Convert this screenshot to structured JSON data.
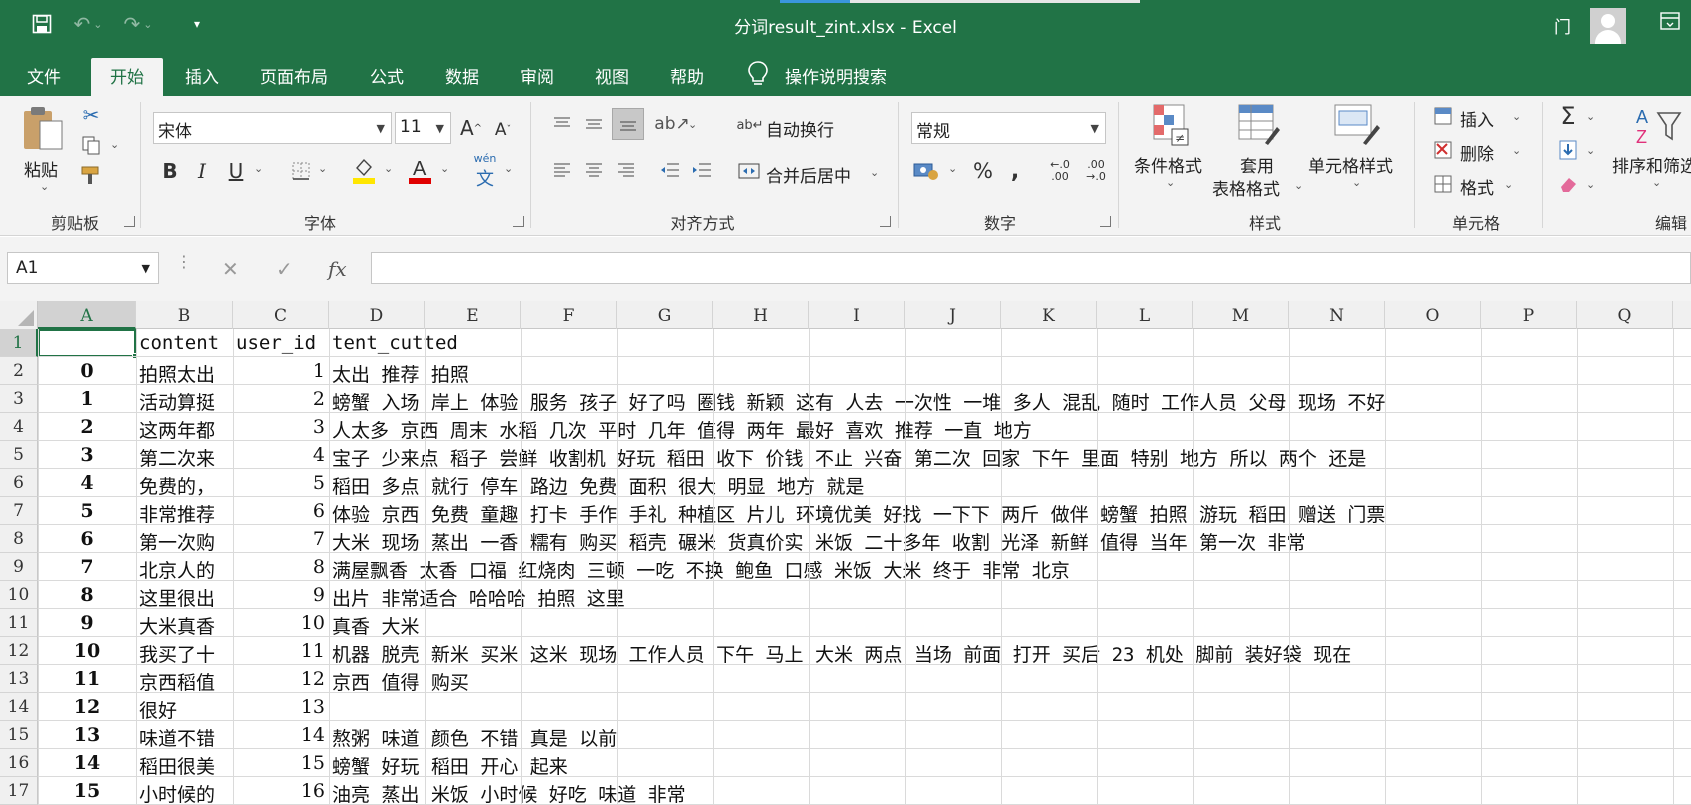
{
  "app": {
    "title": "分词result_zint.xlsx  -  Excel",
    "account_name": "门"
  },
  "tabs": [
    "文件",
    "开始",
    "插入",
    "页面布局",
    "公式",
    "数据",
    "审阅",
    "视图",
    "帮助"
  ],
  "tell_me": "操作说明搜索",
  "ribbon": {
    "clipboard": {
      "paste": "粘贴",
      "label": "剪贴板"
    },
    "font": {
      "name": "宋体",
      "size": "11",
      "label": "字体",
      "phonetic": "wén"
    },
    "alignment": {
      "wrap": "自动换行",
      "merge": "合并后居中",
      "label": "对齐方式"
    },
    "number": {
      "format": "常规",
      "label": "数字"
    },
    "styles": {
      "conditional": "条件格式",
      "table_line1": "套用",
      "table_line2": "表格格式",
      "cell_styles": "单元格样式",
      "label": "样式"
    },
    "cells": {
      "insert": "插入",
      "delete": "删除",
      "format": "格式",
      "label": "单元格"
    },
    "editing": {
      "sort": "排序和筛选",
      "label": "编辑"
    }
  },
  "formula_bar": {
    "name_box": "A1",
    "fx": "fx",
    "value": ""
  },
  "sheet": {
    "columns": [
      "A",
      "B",
      "C",
      "D",
      "E",
      "F",
      "G",
      "H",
      "I",
      "J",
      "K",
      "L",
      "M",
      "N",
      "O",
      "P",
      "Q"
    ],
    "header_row": {
      "a": "",
      "b": "content",
      "c": "user_id",
      "d": "tent_cutted"
    },
    "rows": [
      {
        "n": "1",
        "a": "",
        "b": "content",
        "c": "user_id",
        "d": "tent_cutted"
      },
      {
        "n": "2",
        "a": "0",
        "b": "拍照太出",
        "c": "1",
        "d": "太出 推荐 拍照"
      },
      {
        "n": "3",
        "a": "1",
        "b": "活动算挺",
        "c": "2",
        "d": "螃蟹 入场 岸上 体验 服务 孩子 好了吗 圈钱 新颖 这有 人去 一次性 一堆 多人 混乱 随时 工作人员 父母 现场 不好"
      },
      {
        "n": "4",
        "a": "2",
        "b": "这两年都",
        "c": "3",
        "d": "人太多 京西 周末 水稻 几次 平时 几年 值得 两年 最好 喜欢 推荐 一直 地方"
      },
      {
        "n": "5",
        "a": "3",
        "b": "第二次来",
        "c": "4",
        "d": "宝子 少来点 稻子 尝鲜 收割机 好玩 稻田 收下 价钱 不止 兴奋 第二次 回家 下午 里面 特别 地方 所以 两个 还是"
      },
      {
        "n": "6",
        "a": "4",
        "b": "免费的，",
        "c": "5",
        "d": "稻田 多点 就行 停车 路边 免费 面积 很大 明显 地方 就是"
      },
      {
        "n": "7",
        "a": "5",
        "b": "非常推荐",
        "c": "6",
        "d": "体验 京西 免费 童趣 打卡 手作 手礼 种植区 片儿 环境优美 好找 一下下 两斤 做伴 螃蟹 拍照 游玩 稻田 赠送 门票"
      },
      {
        "n": "8",
        "a": "6",
        "b": "第一次购",
        "c": "7",
        "d": "大米 现场 蒸出 一香 糯有 购买 稻壳 碾米 货真价实 米饭 二十多年 收割 光泽 新鲜 值得 当年 第一次 非常"
      },
      {
        "n": "9",
        "a": "7",
        "b": "北京人的",
        "c": "8",
        "d": "满屋飘香 太香 口福 红烧肉 三顿 一吃 不换 鲍鱼 口感 米饭 大米 终于 非常 北京"
      },
      {
        "n": "10",
        "a": "8",
        "b": "这里很出",
        "c": "9",
        "d": "出片 非常适合 哈哈哈 拍照 这里"
      },
      {
        "n": "11",
        "a": "9",
        "b": "大米真香",
        "c": "10",
        "d": "真香 大米"
      },
      {
        "n": "12",
        "a": "10",
        "b": "我买了十",
        "c": "11",
        "d": "机器 脱壳 新米 买米 这米 现场 工作人员 下午 马上 大米 两点 当场 前面 打开 买后 23 机处 脚前 装好袋 现在"
      },
      {
        "n": "13",
        "a": "11",
        "b": "京西稻值",
        "c": "12",
        "d": "京西 值得 购买"
      },
      {
        "n": "14",
        "a": "12",
        "b": "很好",
        "c": "13",
        "d": ""
      },
      {
        "n": "15",
        "a": "13",
        "b": "味道不错",
        "c": "14",
        "d": "熬粥 味道 颜色 不错 真是 以前"
      },
      {
        "n": "16",
        "a": "14",
        "b": "稻田很美",
        "c": "15",
        "d": "螃蟹 好玩 稻田 开心 起来"
      },
      {
        "n": "17",
        "a": "15",
        "b": "小时候的",
        "c": "16",
        "d": "油亮 蒸出 米饭 小时候 好吃 味道 非常"
      }
    ]
  }
}
